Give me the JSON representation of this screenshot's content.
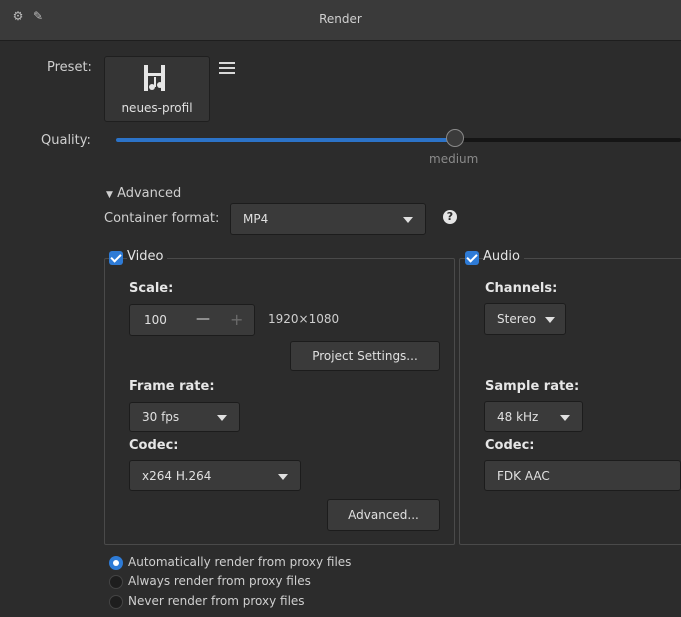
{
  "window": {
    "title": "Render"
  },
  "preset": {
    "label": "Preset:",
    "name": "neues-profil"
  },
  "quality": {
    "label": "Quality:",
    "value_label": "medium",
    "level": 0.6
  },
  "advanced": {
    "toggle_label": "Advanced",
    "container_label": "Container format:",
    "container_value": "MP4",
    "help": "?"
  },
  "video": {
    "title": "Video",
    "enabled": true,
    "scale_label": "Scale:",
    "scale_value": "100",
    "minus": "—",
    "plus": "+",
    "resolution": "1920×1080",
    "project_settings": "Project Settings...",
    "frame_rate_label": "Frame rate:",
    "frame_rate_value": "30 fps",
    "codec_label": "Codec:",
    "codec_value": "x264 H.264",
    "advanced_button": "Advanced..."
  },
  "audio": {
    "title": "Audio",
    "enabled": true,
    "channels_label": "Channels:",
    "channels_value": "Stereo",
    "sample_rate_label": "Sample rate:",
    "sample_rate_value": "48 kHz",
    "codec_label": "Codec:",
    "codec_value": "FDK AAC"
  },
  "proxy": {
    "options": [
      {
        "label": "Automatically render from proxy files",
        "selected": true
      },
      {
        "label": "Always render from proxy files",
        "selected": false
      },
      {
        "label": "Never render from proxy files",
        "selected": false
      }
    ]
  },
  "colors": {
    "accent": "#2e7bd6",
    "background": "#2c2c2c"
  }
}
